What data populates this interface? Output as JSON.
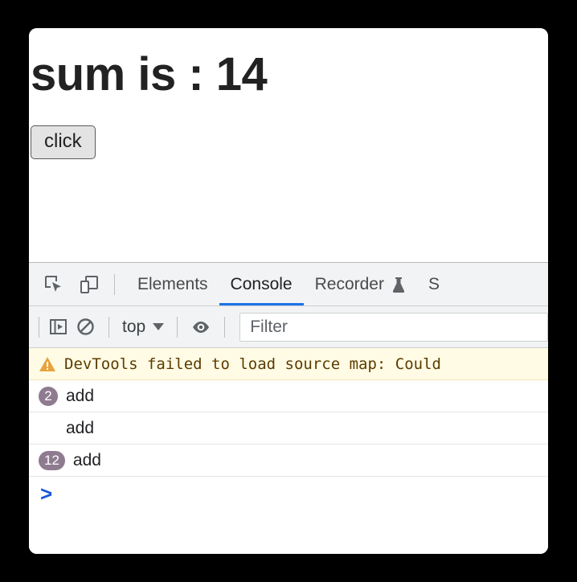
{
  "page": {
    "heading": "sum is : 14",
    "button_label": "click"
  },
  "devtools": {
    "tools": [
      {
        "name": "inspect-element-icon",
        "label": "Inspect element"
      },
      {
        "name": "device-toolbar-icon",
        "label": "Toggle device toolbar"
      }
    ],
    "tabs": [
      {
        "label": "Elements",
        "active": false,
        "icon": ""
      },
      {
        "label": "Console",
        "active": true,
        "icon": ""
      },
      {
        "label": "Recorder",
        "active": false,
        "icon": "flask-icon"
      },
      {
        "label": "S",
        "active": false,
        "icon": ""
      }
    ],
    "console_toolbar": {
      "sidebar_toggle_icon": "console-sidebar-icon",
      "clear_icon": "clear-console-icon",
      "context_value": "top",
      "eye_icon": "live-expression-eye-icon",
      "filter_placeholder": "Filter",
      "filter_value": ""
    },
    "messages": [
      {
        "type": "warning",
        "icon": "warning-triangle-icon",
        "text": "DevTools failed to load source map: Could",
        "count": null
      },
      {
        "type": "log",
        "text": "add",
        "count": "2"
      },
      {
        "type": "log",
        "text": "add",
        "count": null
      },
      {
        "type": "log",
        "text": "add",
        "count": "12"
      }
    ],
    "prompt_symbol": ">"
  },
  "colors": {
    "accent": "#1a73e8",
    "warning_bg": "#fffbe5",
    "warning_text": "#5c3c00",
    "warning_icon": "#e8a33d",
    "badge_bg": "#8f7b8f",
    "prompt": "#1a56db",
    "toolbar_bg": "#f1f3f4",
    "page_bg": "#000000"
  }
}
